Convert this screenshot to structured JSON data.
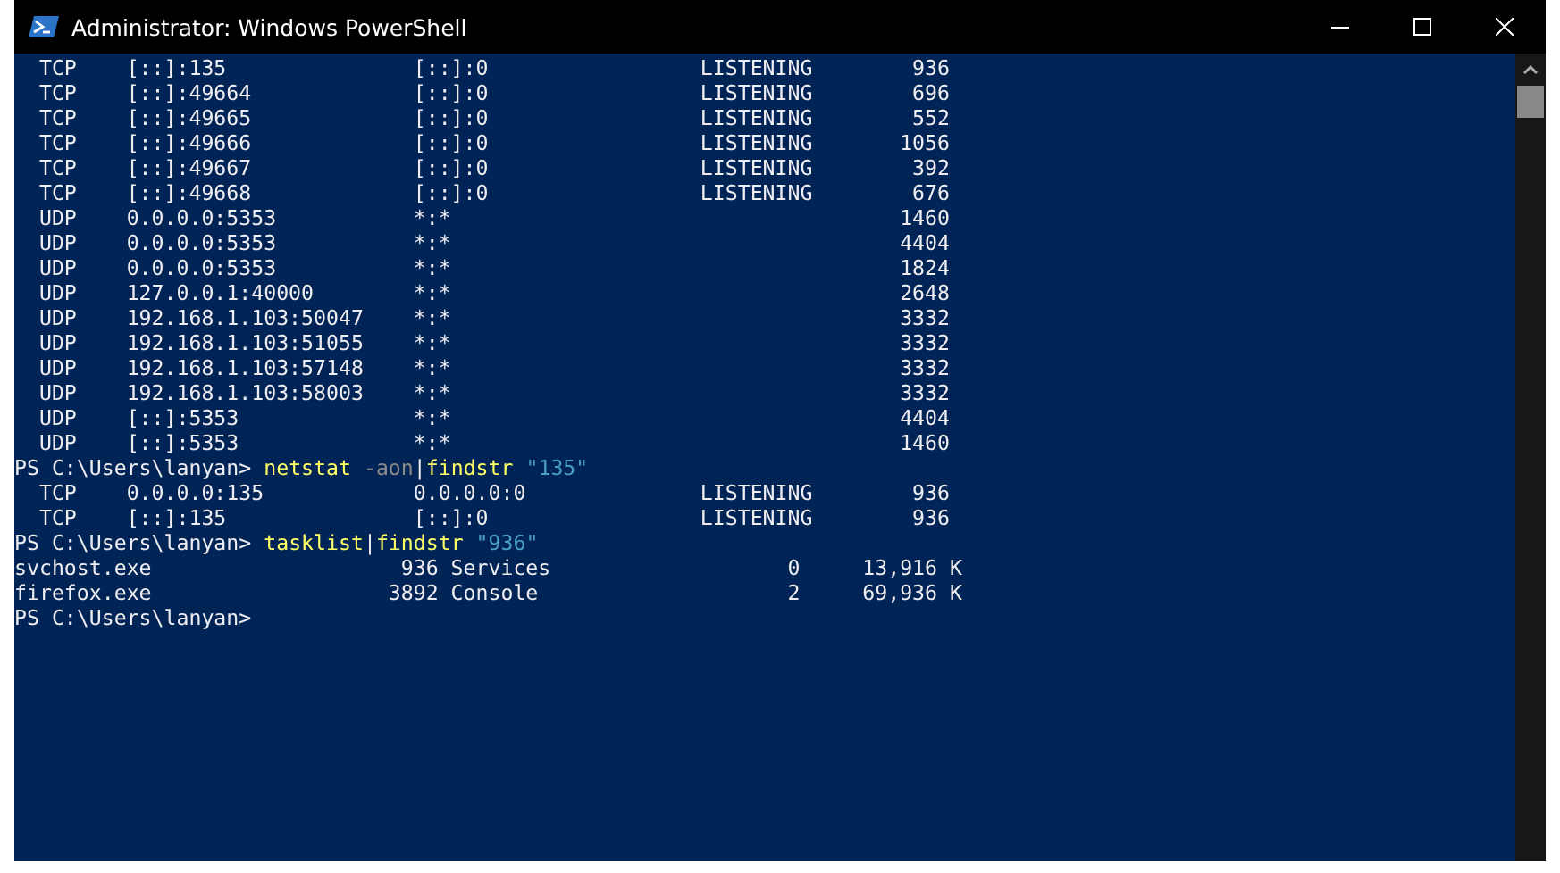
{
  "window": {
    "title": "Administrator: Windows PowerShell"
  },
  "console": {
    "lines": [
      {
        "kind": "netstat",
        "proto": "TCP",
        "local": "[::]:135",
        "foreign": "[::]:0",
        "state": "LISTENING",
        "pid": "936"
      },
      {
        "kind": "netstat",
        "proto": "TCP",
        "local": "[::]:49664",
        "foreign": "[::]:0",
        "state": "LISTENING",
        "pid": "696"
      },
      {
        "kind": "netstat",
        "proto": "TCP",
        "local": "[::]:49665",
        "foreign": "[::]:0",
        "state": "LISTENING",
        "pid": "552"
      },
      {
        "kind": "netstat",
        "proto": "TCP",
        "local": "[::]:49666",
        "foreign": "[::]:0",
        "state": "LISTENING",
        "pid": "1056"
      },
      {
        "kind": "netstat",
        "proto": "TCP",
        "local": "[::]:49667",
        "foreign": "[::]:0",
        "state": "LISTENING",
        "pid": "392"
      },
      {
        "kind": "netstat",
        "proto": "TCP",
        "local": "[::]:49668",
        "foreign": "[::]:0",
        "state": "LISTENING",
        "pid": "676"
      },
      {
        "kind": "netstat",
        "proto": "UDP",
        "local": "0.0.0.0:5353",
        "foreign": "*:*",
        "pid": "1460"
      },
      {
        "kind": "netstat",
        "proto": "UDP",
        "local": "0.0.0.0:5353",
        "foreign": "*:*",
        "pid": "4404"
      },
      {
        "kind": "netstat",
        "proto": "UDP",
        "local": "0.0.0.0:5353",
        "foreign": "*:*",
        "pid": "1824"
      },
      {
        "kind": "netstat",
        "proto": "UDP",
        "local": "127.0.0.1:40000",
        "foreign": "*:*",
        "pid": "2648"
      },
      {
        "kind": "netstat",
        "proto": "UDP",
        "local": "192.168.1.103:50047",
        "foreign": "*:*",
        "pid": "3332"
      },
      {
        "kind": "netstat",
        "proto": "UDP",
        "local": "192.168.1.103:51055",
        "foreign": "*:*",
        "pid": "3332"
      },
      {
        "kind": "netstat",
        "proto": "UDP",
        "local": "192.168.1.103:57148",
        "foreign": "*:*",
        "pid": "3332"
      },
      {
        "kind": "netstat",
        "proto": "UDP",
        "local": "192.168.1.103:58003",
        "foreign": "*:*",
        "pid": "3332"
      },
      {
        "kind": "netstat",
        "proto": "UDP",
        "local": "[::]:5353",
        "foreign": "*:*",
        "pid": "4404"
      },
      {
        "kind": "netstat",
        "proto": "UDP",
        "local": "[::]:5353",
        "foreign": "*:*",
        "pid": "1460"
      },
      {
        "kind": "prompt",
        "prompt": "PS C:\\Users\\lanyan> ",
        "parts": [
          {
            "kind": "command",
            "text": "netstat"
          },
          {
            "kind": "parameter",
            "text": " -aon"
          },
          {
            "kind": "pipe",
            "text": "|"
          },
          {
            "kind": "command",
            "text": "findstr"
          },
          {
            "kind": "string",
            "text": " \"135\""
          }
        ]
      },
      {
        "kind": "netstat",
        "proto": "TCP",
        "local": "0.0.0.0:135",
        "foreign": "0.0.0.0:0",
        "state": "LISTENING",
        "pid": "936"
      },
      {
        "kind": "netstat",
        "proto": "TCP",
        "local": "[::]:135",
        "foreign": "[::]:0",
        "state": "LISTENING",
        "pid": "936"
      },
      {
        "kind": "prompt",
        "prompt": "PS C:\\Users\\lanyan> ",
        "parts": [
          {
            "kind": "command",
            "text": "tasklist"
          },
          {
            "kind": "pipe",
            "text": "|"
          },
          {
            "kind": "command",
            "text": "findstr"
          },
          {
            "kind": "string",
            "text": " \"936\""
          }
        ]
      },
      {
        "kind": "tasklist",
        "image": "svchost.exe",
        "pid": "936",
        "session_name": "Services",
        "session": "0",
        "memory": "13,916 K"
      },
      {
        "kind": "tasklist",
        "image": "firefox.exe",
        "pid": "3892",
        "session_name": "Console",
        "session": "2",
        "memory": "69,936 K"
      },
      {
        "kind": "prompt",
        "prompt": "PS C:\\Users\\lanyan>"
      }
    ]
  }
}
